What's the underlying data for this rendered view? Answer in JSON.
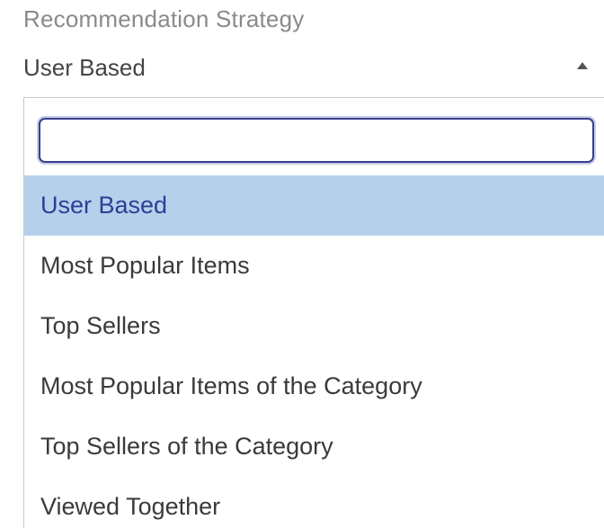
{
  "field": {
    "label": "Recommendation Strategy",
    "selected_value": "User Based"
  },
  "dropdown": {
    "search_value": "",
    "options": [
      {
        "label": "User Based",
        "selected": true
      },
      {
        "label": "Most Popular Items",
        "selected": false
      },
      {
        "label": "Top Sellers",
        "selected": false
      },
      {
        "label": "Most Popular Items of the Category",
        "selected": false
      },
      {
        "label": "Top Sellers of the Category",
        "selected": false
      },
      {
        "label": "Viewed Together",
        "selected": false
      }
    ]
  },
  "colors": {
    "selected_background": "#b6d0ec",
    "selected_text": "#2b3f94",
    "focus_border": "#3a3f8f"
  },
  "icons": {
    "caret": "caret-up-icon"
  }
}
